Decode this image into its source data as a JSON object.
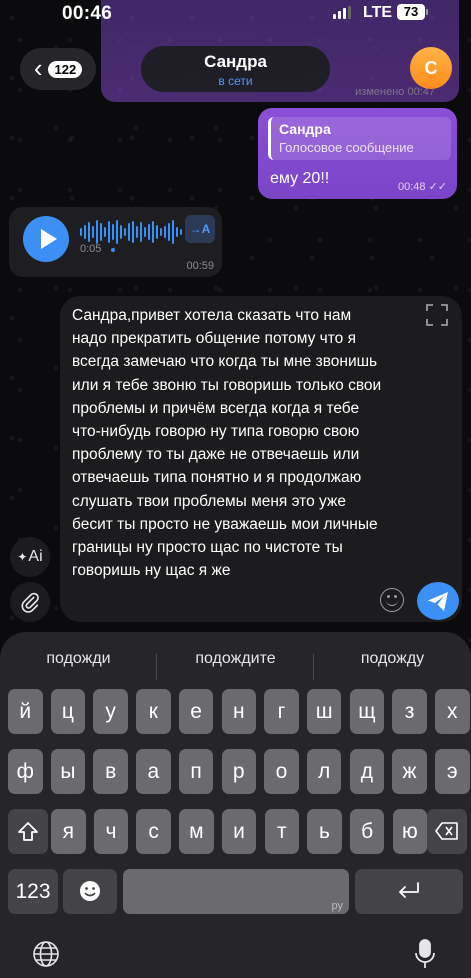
{
  "status_bar": {
    "time": "00:46",
    "network": "LTE",
    "battery": "73"
  },
  "hidden_message": {
    "edited_label": "изменено 00:47"
  },
  "header": {
    "back_count": "122",
    "contact_name": "Сандра",
    "contact_status": "в сети",
    "avatar_letter": "С"
  },
  "messages": {
    "outgoing": {
      "reply_name": "Сандра",
      "reply_text": "Голосовое сообщение",
      "text": "ему 20!!",
      "time": "00:48"
    },
    "voice": {
      "duration": "0:05",
      "transcribe_label": "→A",
      "time": "00:59"
    }
  },
  "composer": {
    "text": "Сандра,привет хотела сказать что нам надо прекратить общение потому что я всегда замечаю что когда ты мне звонишь или я тебе звоню ты говоришь только свои проблемы и причём всегда когда я тебе что-нибудь говорю ну типа говорю свою проблему то ты даже не отвечаешь или отвечаешь типа понятно и я продолжаю слушать твои проблемы меня это уже бесит ты просто не уважаешь мои личные границы ну просто щас по чистоте ты говоришь ну щас я же",
    "ai_label": "Ai"
  },
  "keyboard": {
    "suggestions": [
      "подожди",
      "подождите",
      "подожду"
    ],
    "row1": [
      "й",
      "ц",
      "у",
      "к",
      "е",
      "н",
      "г",
      "ш",
      "щ",
      "з",
      "х"
    ],
    "row2": [
      "ф",
      "ы",
      "в",
      "а",
      "п",
      "р",
      "о",
      "л",
      "д",
      "ж",
      "э"
    ],
    "row3": [
      "я",
      "ч",
      "с",
      "м",
      "и",
      "т",
      "ь",
      "б",
      "ю"
    ],
    "numbers_key": "123",
    "space_lang": "ру"
  },
  "colors": {
    "accent": "#3b8ff5",
    "outgoing_bubble": "#8a4fd6",
    "background": "#0b0b0d"
  }
}
